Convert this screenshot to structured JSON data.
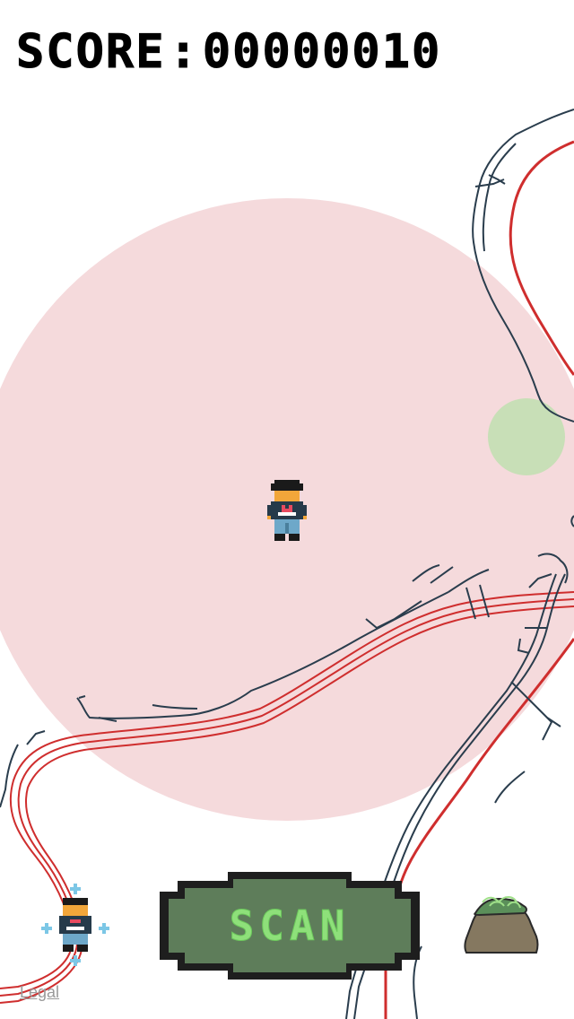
{
  "hud": {
    "score_label": "SCORE",
    "score_separator": ":",
    "score_value": "00000010"
  },
  "actions": {
    "scan_label": "SCAN"
  },
  "footer": {
    "legal_link": "Legal"
  },
  "colors": {
    "scan_radius": "#f5dadc",
    "nearby_target": "#c8dfb7",
    "roads": "#2a3d4d",
    "highway": "#cf2e2e",
    "scan_button_fill": "#5e7d5a",
    "scan_button_text": "#8ee07a",
    "bag": "#857860"
  },
  "icons": {
    "player": "player-avatar-icon",
    "self_locate": "center-on-player-icon",
    "bag": "inventory-bag-icon"
  }
}
